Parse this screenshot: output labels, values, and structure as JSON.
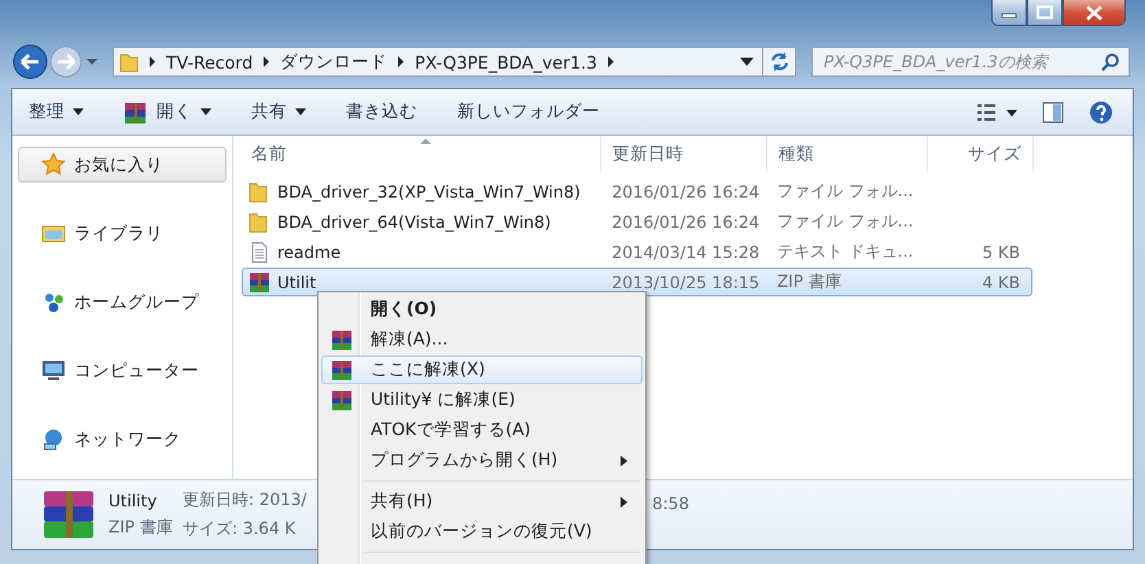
{
  "address_bar": {
    "path": [
      "TV-Record",
      "ダウンロード",
      "PX-Q3PE_BDA_ver1.3"
    ]
  },
  "search": {
    "placeholder": "PX-Q3PE_BDA_ver1.3の検索"
  },
  "toolbar": [
    {
      "label": "整理",
      "kind": "plain",
      "dropdown": true
    },
    {
      "label": "開く",
      "kind": "archive",
      "dropdown": true
    },
    {
      "label": "共有",
      "kind": "plain",
      "dropdown": true
    },
    {
      "label": "書き込む",
      "kind": "plain",
      "dropdown": false
    },
    {
      "label": "新しいフォルダー",
      "kind": "plain",
      "dropdown": false
    }
  ],
  "sidebar": [
    {
      "label": "お気に入り",
      "kind": "star",
      "selected": true
    },
    {
      "label": "ライブラリ",
      "kind": "library",
      "selected": false
    },
    {
      "label": "ホームグループ",
      "kind": "homegroup",
      "selected": false
    },
    {
      "label": "コンピューター",
      "kind": "computer",
      "selected": false
    },
    {
      "label": "ネットワーク",
      "kind": "network",
      "selected": false
    }
  ],
  "table": {
    "columns": [
      "名前",
      "更新日時",
      "種類",
      "サイズ"
    ],
    "rows": [
      {
        "kind": "folder",
        "name": "BDA_driver_32(XP_Vista_Win7_Win8)",
        "date": "2016/01/26 16:24",
        "type": "ファイル フォル...",
        "size": "",
        "selected": false
      },
      {
        "kind": "folder",
        "name": "BDA_driver_64(Vista_Win7_Win8)",
        "date": "2016/01/26 16:24",
        "type": "ファイル フォル...",
        "size": "",
        "selected": false
      },
      {
        "kind": "text",
        "name": "readme",
        "date": "2014/03/14 15:28",
        "type": "テキスト ドキュ...",
        "size": "5 KB",
        "selected": false
      },
      {
        "kind": "archive",
        "name": "Utilit",
        "date": "2013/10/25 18:15",
        "type": "ZIP 書庫",
        "size": "4 KB",
        "selected": true
      }
    ]
  },
  "context_menu": {
    "items": [
      {
        "kind": "item",
        "label": "開く(O)",
        "default": true,
        "icon": false,
        "submenu": false,
        "highlighted": false
      },
      {
        "kind": "item",
        "label": "解凍(A)...",
        "default": false,
        "icon": true,
        "submenu": false,
        "highlighted": false
      },
      {
        "kind": "item",
        "label": "ここに解凍(X)",
        "default": false,
        "icon": true,
        "submenu": false,
        "highlighted": true
      },
      {
        "kind": "item",
        "label": "Utility¥ に解凍(E)",
        "default": false,
        "icon": true,
        "submenu": false,
        "highlighted": false
      },
      {
        "kind": "item",
        "label": "ATOKで学習する(A)",
        "default": false,
        "icon": false,
        "submenu": false,
        "highlighted": false
      },
      {
        "kind": "item",
        "label": "プログラムから開く(H)",
        "default": false,
        "icon": false,
        "submenu": true,
        "highlighted": false
      },
      {
        "kind": "separator"
      },
      {
        "kind": "item",
        "label": "共有(H)",
        "default": false,
        "icon": false,
        "submenu": true,
        "highlighted": false
      },
      {
        "kind": "item",
        "label": "以前のバージョンの復元(V)",
        "default": false,
        "icon": false,
        "submenu": false,
        "highlighted": false
      },
      {
        "kind": "separator"
      }
    ]
  },
  "details_pane": {
    "name": "Utility",
    "type": "ZIP 書庫",
    "modified": "更新日時: 2013/",
    "size": "サイズ: 3.64 K",
    "time_fragment": "8:58"
  }
}
